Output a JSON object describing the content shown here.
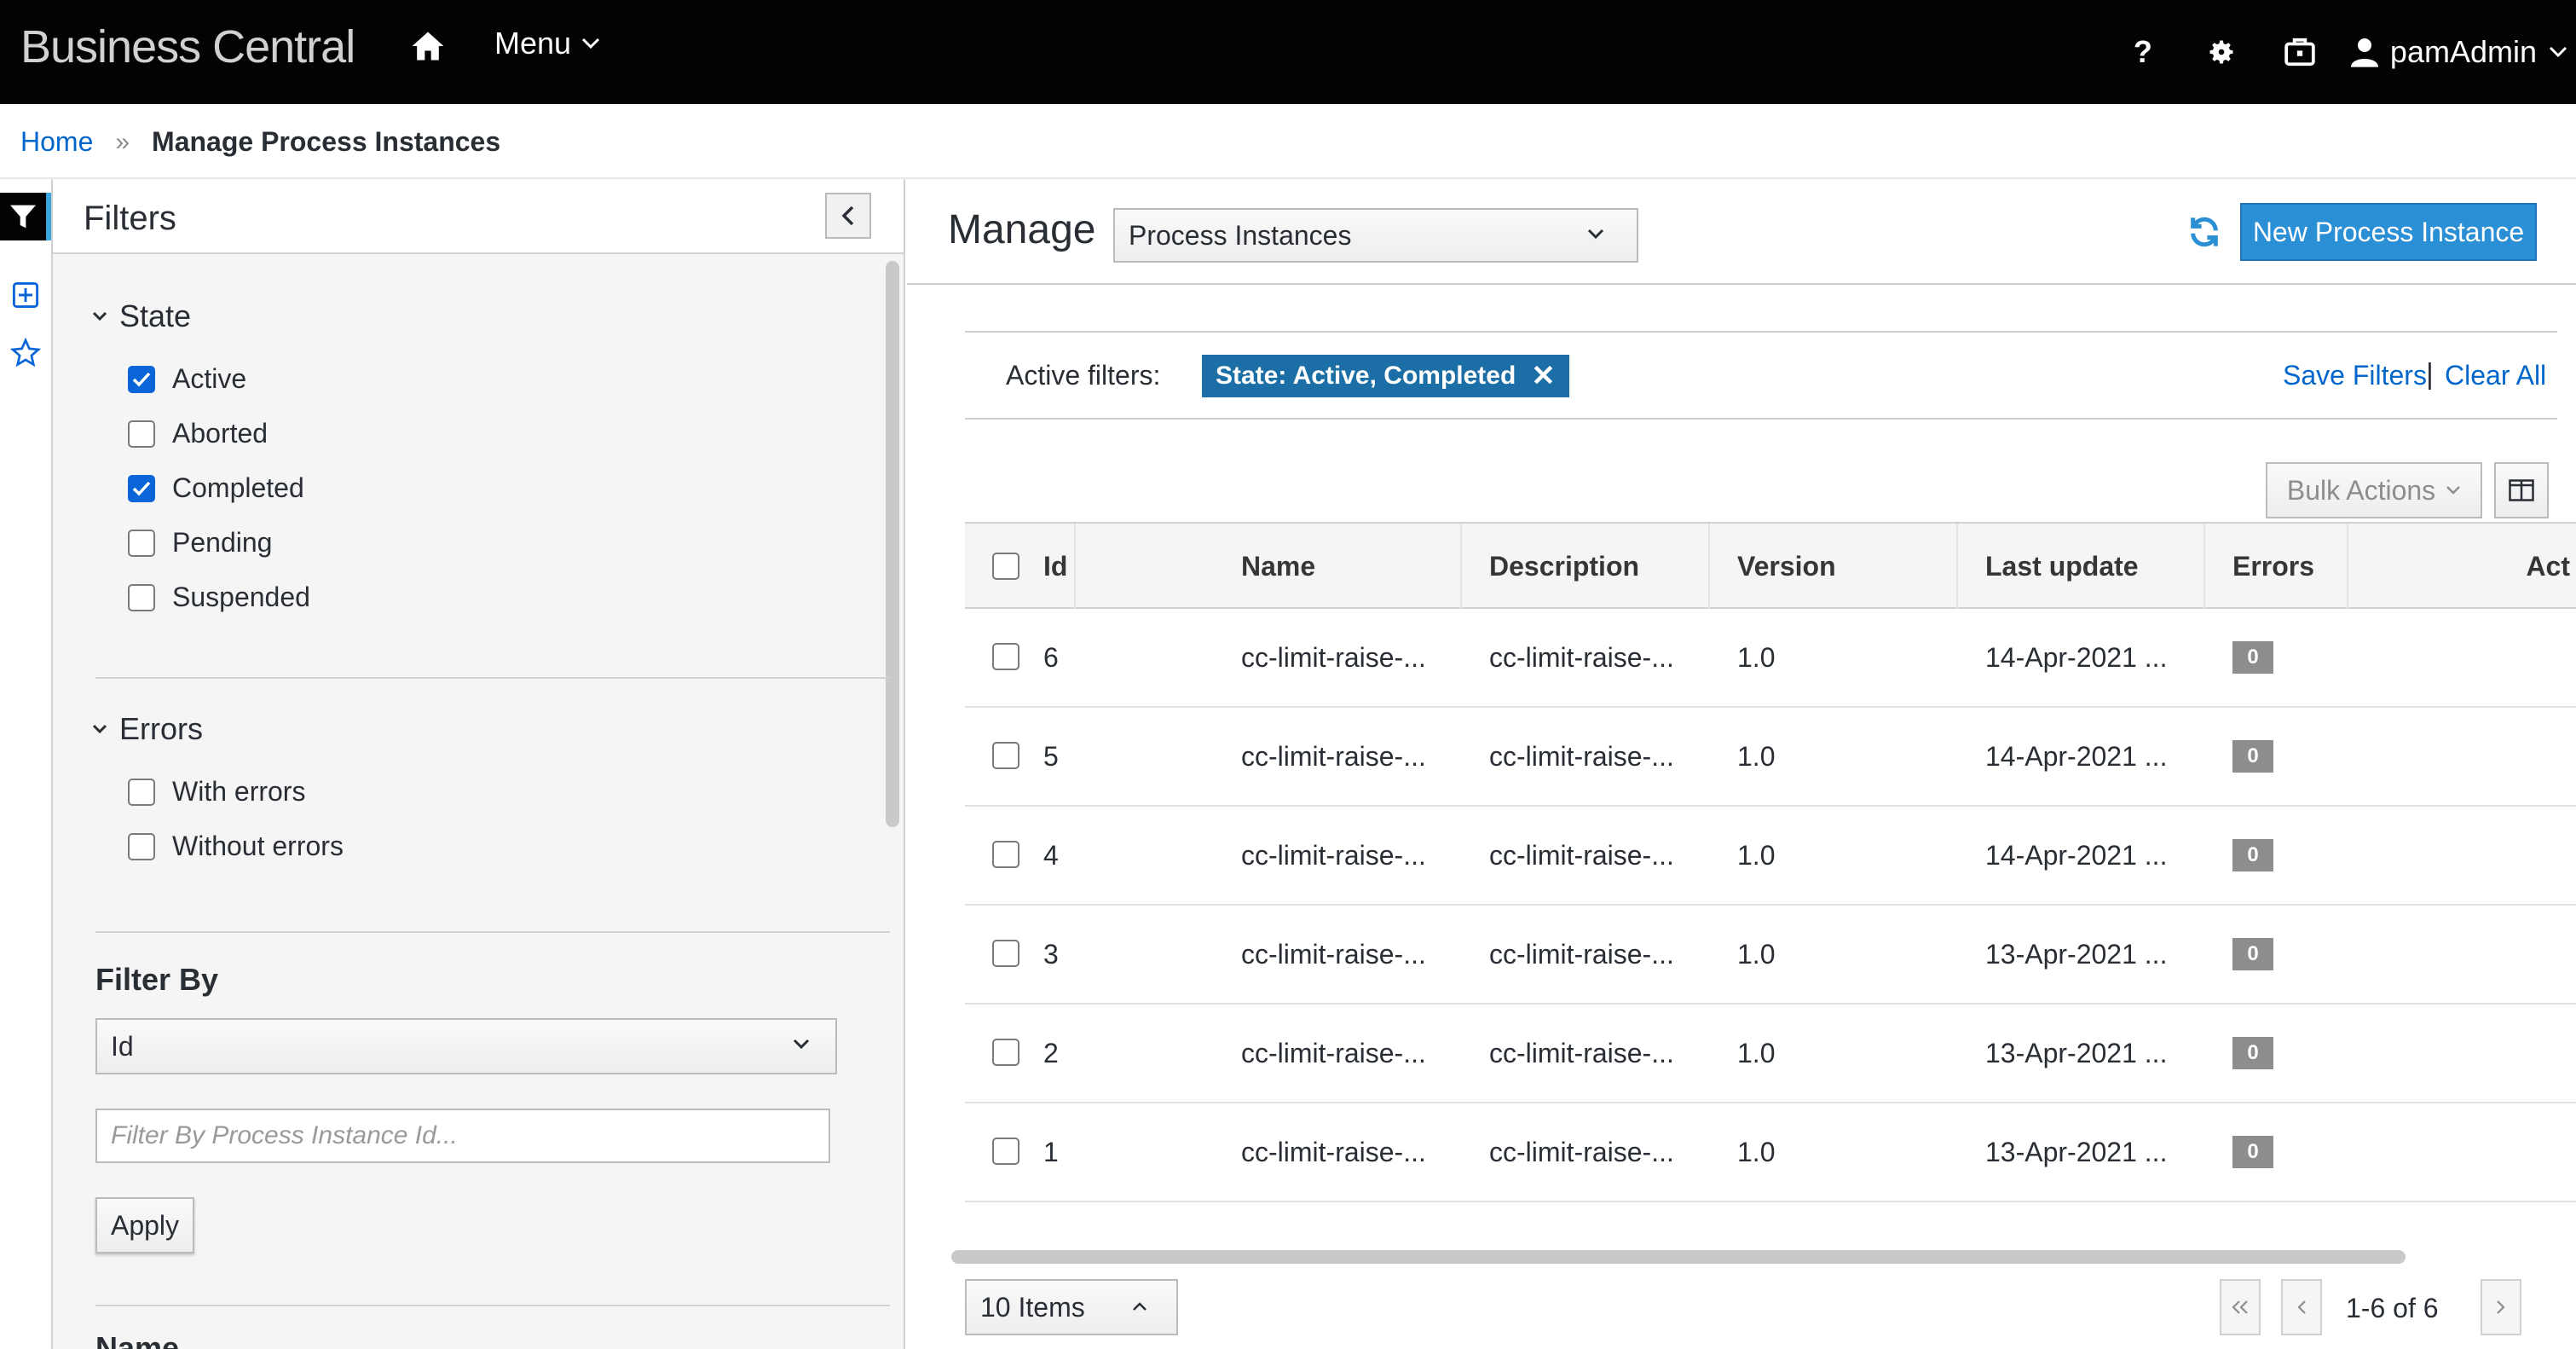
{
  "header": {
    "brand": "Business Central",
    "menu_label": "Menu",
    "user_name": "pamAdmin",
    "icons": [
      "home-icon",
      "help-icon",
      "gear-icon",
      "briefcase-icon",
      "user-icon"
    ]
  },
  "breadcrumb": {
    "home": "Home",
    "current": "Manage Process Instances"
  },
  "filters": {
    "title": "Filters",
    "state_section": {
      "title": "State",
      "options": [
        {
          "label": "Active",
          "checked": true
        },
        {
          "label": "Aborted",
          "checked": false
        },
        {
          "label": "Completed",
          "checked": true
        },
        {
          "label": "Pending",
          "checked": false
        },
        {
          "label": "Suspended",
          "checked": false
        }
      ]
    },
    "errors_section": {
      "title": "Errors",
      "options": [
        {
          "label": "With errors",
          "checked": false
        },
        {
          "label": "Without errors",
          "checked": false
        }
      ]
    },
    "filter_by": {
      "title": "Filter By",
      "selected": "Id",
      "placeholder": "Filter By Process Instance Id...",
      "apply_label": "Apply"
    },
    "next_section_title": "Name"
  },
  "main": {
    "title": "Manage",
    "view_select": "Process Instances",
    "new_button": "New Process Instance",
    "active_filters_label": "Active filters:",
    "active_chip": "State: Active, Completed",
    "save_filters": "Save Filters",
    "separator": "|",
    "clear_all": "Clear All",
    "bulk_actions": "Bulk Actions"
  },
  "table": {
    "columns": [
      "Id",
      "Name",
      "Description",
      "Version",
      "Last update",
      "Errors",
      "Act"
    ],
    "rows": [
      {
        "id": "6",
        "name": "cc-limit-raise-...",
        "description": "cc-limit-raise-...",
        "version": "1.0",
        "last_update": "14-Apr-2021 ...",
        "errors": "0"
      },
      {
        "id": "5",
        "name": "cc-limit-raise-...",
        "description": "cc-limit-raise-...",
        "version": "1.0",
        "last_update": "14-Apr-2021 ...",
        "errors": "0"
      },
      {
        "id": "4",
        "name": "cc-limit-raise-...",
        "description": "cc-limit-raise-...",
        "version": "1.0",
        "last_update": "14-Apr-2021 ...",
        "errors": "0"
      },
      {
        "id": "3",
        "name": "cc-limit-raise-...",
        "description": "cc-limit-raise-...",
        "version": "1.0",
        "last_update": "13-Apr-2021 ...",
        "errors": "0"
      },
      {
        "id": "2",
        "name": "cc-limit-raise-...",
        "description": "cc-limit-raise-...",
        "version": "1.0",
        "last_update": "13-Apr-2021 ...",
        "errors": "0"
      },
      {
        "id": "1",
        "name": "cc-limit-raise-...",
        "description": "cc-limit-raise-...",
        "version": "1.0",
        "last_update": "13-Apr-2021 ...",
        "errors": "0"
      }
    ]
  },
  "pagination": {
    "page_size": "10 Items",
    "range": "1-6 of 6"
  },
  "colors": {
    "topbar": "#030303",
    "primary": "#2b8fd6",
    "link": "#0066cc",
    "chip": "#1c6fa6",
    "checkbox_checked": "#0a66d8",
    "badge": "#8b8d8f"
  }
}
